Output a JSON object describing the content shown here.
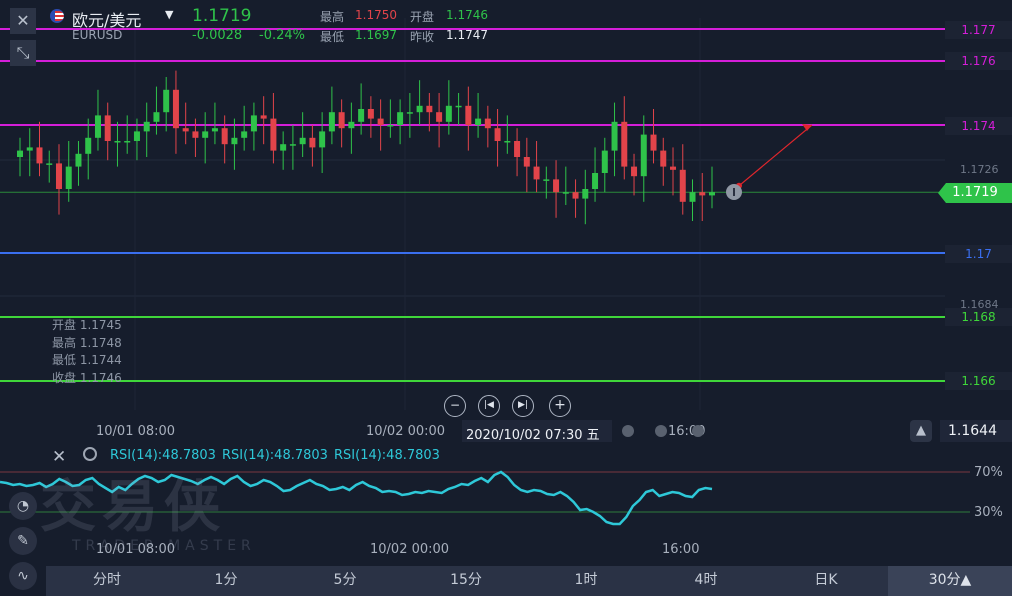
{
  "header": {
    "symbol_cn": "欧元/美元",
    "symbol_code": "EURUSD",
    "last_price": "1.1719",
    "change": "-0.0028",
    "change_pct": "-0.24%",
    "high_label": "最高",
    "high_value": "1.1750",
    "open_label": "开盘",
    "open_value": "1.1746",
    "low_label": "最低",
    "low_value": "1.1697",
    "prevclose_label": "昨收",
    "prevclose_value": "1.1747"
  },
  "price_levels": {
    "p1177": "1.177",
    "p1176": "1.176",
    "p1174": "1.174",
    "p1726": "1.1726",
    "p1719": "1.1719",
    "p117": "1.17",
    "p1684": "1.1684",
    "p1168": "1.168",
    "p1166": "1.166"
  },
  "ohlc_panel": {
    "open": "开盘 1.1745",
    "high": "最高 1.1748",
    "low": "最低 1.1744",
    "close": "收盘 1.1746"
  },
  "crosshair": {
    "datetime": "2020/10/02 07:30 五",
    "price": "1.1644"
  },
  "time_axis": {
    "t1": "10/01 08:00",
    "t2": "10/02 00:00",
    "t3": "16:00"
  },
  "rsi": {
    "label1": "RSI(14):48.7803",
    "label2": "RSI(14):48.7803",
    "label3": "RSI(14):48.7803",
    "level_high": "70%",
    "level_low": "30%",
    "values": [
      60,
      59,
      57,
      58,
      56,
      57,
      59,
      55,
      58,
      63,
      60,
      56,
      57,
      62,
      64,
      58,
      54,
      50,
      55,
      52,
      58,
      63,
      66,
      64,
      60,
      62,
      67,
      65,
      63,
      61,
      58,
      62,
      65,
      62,
      58,
      63,
      66,
      60,
      56,
      58,
      62,
      60,
      56,
      51,
      52,
      56,
      59,
      62,
      58,
      56,
      52,
      53,
      55,
      52,
      57,
      60,
      56,
      54,
      50,
      51,
      50,
      47,
      48,
      50,
      49,
      51,
      50,
      49,
      53,
      55,
      58,
      57,
      61,
      64,
      60,
      67,
      70,
      65,
      57,
      52,
      50,
      52,
      51,
      48,
      47,
      50,
      46,
      40,
      32,
      33,
      30,
      26,
      20,
      18,
      18,
      25,
      36,
      42,
      50,
      52,
      46,
      48,
      50,
      49,
      46,
      45,
      52,
      54,
      53
    ],
    "color": "#2ec8d8"
  },
  "watermark": {
    "main": "交易侠",
    "sub": "TRADER MASTER"
  },
  "timeframes": [
    "分时",
    "1分",
    "5分",
    "15分",
    "1时",
    "4时",
    "日K",
    "30分▲"
  ],
  "colors": {
    "magenta": "#d41ed8",
    "blue": "#3a6ff0",
    "green": "#3fd63a",
    "up": "#2fc34a",
    "down": "#e2444a",
    "background": "#161d2c"
  },
  "candles": {
    "o": [
      1.173,
      1.1732,
      1.1733,
      1.1728,
      1.1728,
      1.172,
      1.1727,
      1.1731,
      1.1736,
      1.1743,
      1.1735,
      1.1735,
      1.1735,
      1.1738,
      1.1741,
      1.1744,
      1.1751,
      1.1739,
      1.1738,
      1.1736,
      1.1738,
      1.1739,
      1.1734,
      1.1736,
      1.1738,
      1.1743,
      1.1742,
      1.1732,
      1.1734,
      1.1734,
      1.1736,
      1.1733,
      1.1738,
      1.1744,
      1.1739,
      1.1741,
      1.1745,
      1.1742,
      1.174,
      1.174,
      1.1744,
      1.1744,
      1.1746,
      1.1744,
      1.1741,
      1.1746,
      1.1746,
      1.174,
      1.1742,
      1.1739,
      1.1735,
      1.1735,
      1.173,
      1.1727,
      1.1723,
      1.1723,
      1.1719,
      1.1719,
      1.1717,
      1.172,
      1.1725,
      1.1732,
      1.1741,
      1.1727,
      1.1724,
      1.1737,
      1.1732,
      1.1727,
      1.1726,
      1.1716,
      1.1719,
      1.1718
    ],
    "c": [
      1.1732,
      1.1733,
      1.1728,
      1.1728,
      1.172,
      1.1727,
      1.1731,
      1.1736,
      1.1743,
      1.1735,
      1.1735,
      1.1735,
      1.1738,
      1.1741,
      1.1744,
      1.1751,
      1.1739,
      1.1738,
      1.1736,
      1.1738,
      1.1739,
      1.1734,
      1.1736,
      1.1738,
      1.1743,
      1.1742,
      1.1732,
      1.1734,
      1.1734,
      1.1736,
      1.1733,
      1.1738,
      1.1744,
      1.1739,
      1.1741,
      1.1745,
      1.1742,
      1.174,
      1.174,
      1.1744,
      1.1744,
      1.1746,
      1.1744,
      1.1741,
      1.1746,
      1.1746,
      1.174,
      1.1742,
      1.1739,
      1.1735,
      1.1735,
      1.173,
      1.1727,
      1.1723,
      1.1723,
      1.1719,
      1.1719,
      1.1717,
      1.172,
      1.1725,
      1.1732,
      1.1741,
      1.1727,
      1.1724,
      1.1737,
      1.1732,
      1.1727,
      1.1726,
      1.1716,
      1.1719,
      1.1718,
      1.1719
    ]
  }
}
